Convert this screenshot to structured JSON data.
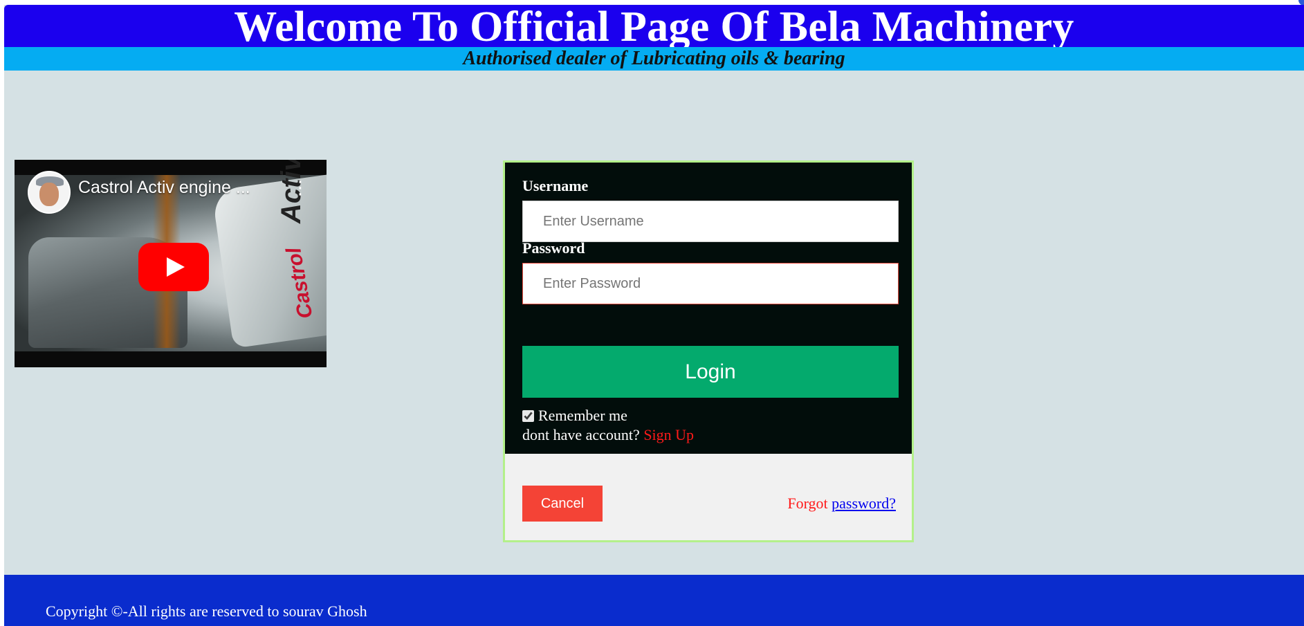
{
  "header": {
    "title": "Welcome To Official Page Of Bela Machinery",
    "subtitle": "Authorised dealer of Lubricating oils & bearing"
  },
  "video": {
    "title": "Castrol Activ engine ...",
    "overlay_brand": "Castrol",
    "overlay_product": "Activ",
    "play_icon": "play-icon",
    "menu_icon": "more-vert-icon"
  },
  "login": {
    "username_label": "Username",
    "username_placeholder": "Enter Username",
    "password_label": "Password",
    "password_placeholder": "Enter Password",
    "login_button": "Login",
    "remember_label": "Remember me",
    "remember_checked": true,
    "no_account_text": "dont have account?",
    "signup_link": "Sign Up",
    "cancel_button": "Cancel",
    "forgot_text": "Forgot",
    "forgot_link": "password?"
  },
  "footer": {
    "copyright": "Copyright ©-All rights are reserved to sourav Ghosh"
  },
  "colors": {
    "header_bg": "#1b00ee",
    "subheader_bg": "#05acf2",
    "page_bg": "#d5e1e4",
    "login_panel_bg": "#020d0b",
    "login_border": "#b3f08a",
    "login_button": "#04aa6d",
    "cancel_button": "#f44336",
    "footer_bg": "#0a2ccd",
    "youtube_red": "#ff0000"
  }
}
